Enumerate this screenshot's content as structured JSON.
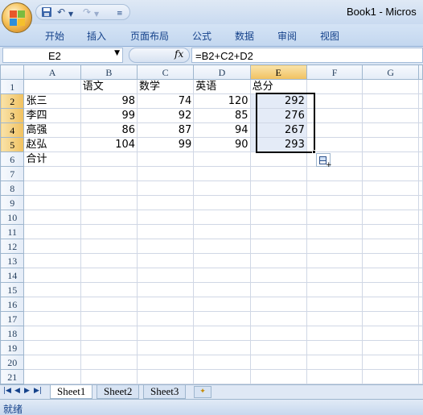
{
  "app": {
    "title": "Book1 - Micros"
  },
  "qat": {
    "save_icon": "floppy-disk-icon",
    "undo_icon": "undo-arrow-icon",
    "redo_icon": "redo-arrow-icon",
    "customize_icon": "dropdown-icon"
  },
  "ribbon": {
    "tabs": [
      "开始",
      "插入",
      "页面布局",
      "公式",
      "数据",
      "审阅",
      "视图"
    ]
  },
  "formula_bar": {
    "name_box": "E2",
    "fx_label": "fx",
    "formula": "=B2+C2+D2"
  },
  "sheet": {
    "columns": [
      "A",
      "B",
      "C",
      "D",
      "E",
      "F",
      "G"
    ],
    "selected_column": "E",
    "rows": [
      [
        "",
        "语文",
        "数学",
        "英语",
        "总分",
        "",
        ""
      ],
      [
        "张三",
        "98",
        "74",
        "120",
        "292",
        "",
        ""
      ],
      [
        "李四",
        "99",
        "92",
        "85",
        "276",
        "",
        ""
      ],
      [
        "高强",
        "86",
        "87",
        "94",
        "267",
        "",
        ""
      ],
      [
        "赵弘",
        "104",
        "99",
        "90",
        "293",
        "",
        ""
      ],
      [
        "合计",
        "",
        "",
        "",
        "",
        "",
        ""
      ],
      [
        "",
        "",
        "",
        "",
        "",
        "",
        ""
      ],
      [
        "",
        "",
        "",
        "",
        "",
        "",
        ""
      ],
      [
        "",
        "",
        "",
        "",
        "",
        "",
        ""
      ],
      [
        "",
        "",
        "",
        "",
        "",
        "",
        ""
      ],
      [
        "",
        "",
        "",
        "",
        "",
        "",
        ""
      ],
      [
        "",
        "",
        "",
        "",
        "",
        "",
        ""
      ],
      [
        "",
        "",
        "",
        "",
        "",
        "",
        ""
      ],
      [
        "",
        "",
        "",
        "",
        "",
        "",
        ""
      ],
      [
        "",
        "",
        "",
        "",
        "",
        "",
        ""
      ],
      [
        "",
        "",
        "",
        "",
        "",
        "",
        ""
      ],
      [
        "",
        "",
        "",
        "",
        "",
        "",
        ""
      ],
      [
        "",
        "",
        "",
        "",
        "",
        "",
        ""
      ],
      [
        "",
        "",
        "",
        "",
        "",
        "",
        ""
      ],
      [
        "",
        "",
        "",
        "",
        "",
        "",
        ""
      ],
      [
        "",
        "",
        "",
        "",
        "",
        "",
        ""
      ]
    ],
    "row_numbers": [
      "1",
      "2",
      "3",
      "4",
      "5",
      "6",
      "7",
      "8",
      "9",
      "10",
      "11",
      "12",
      "13",
      "14",
      "15",
      "16",
      "17",
      "18",
      "19",
      "20",
      "21"
    ],
    "selected_rows": [
      "2",
      "3",
      "4",
      "5"
    ]
  },
  "sheet_tabs": {
    "tabs": [
      "Sheet1",
      "Sheet2",
      "Sheet3"
    ],
    "active": "Sheet1",
    "new_sheet_icon": "insert-worksheet-icon"
  },
  "status_bar": {
    "status": "就绪"
  },
  "colors": {
    "selected_header": "#f1c15f",
    "selection_fill": "#e4ebf7",
    "ribbon_text": "#15428b"
  }
}
